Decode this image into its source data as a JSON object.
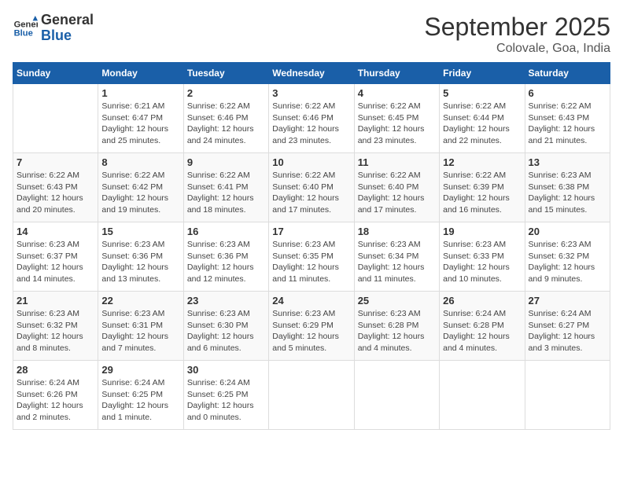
{
  "header": {
    "logo_line1": "General",
    "logo_line2": "Blue",
    "month": "September 2025",
    "location": "Colovale, Goa, India"
  },
  "weekdays": [
    "Sunday",
    "Monday",
    "Tuesday",
    "Wednesday",
    "Thursday",
    "Friday",
    "Saturday"
  ],
  "weeks": [
    [
      {
        "day": "",
        "info": ""
      },
      {
        "day": "1",
        "info": "Sunrise: 6:21 AM\nSunset: 6:47 PM\nDaylight: 12 hours\nand 25 minutes."
      },
      {
        "day": "2",
        "info": "Sunrise: 6:22 AM\nSunset: 6:46 PM\nDaylight: 12 hours\nand 24 minutes."
      },
      {
        "day": "3",
        "info": "Sunrise: 6:22 AM\nSunset: 6:46 PM\nDaylight: 12 hours\nand 23 minutes."
      },
      {
        "day": "4",
        "info": "Sunrise: 6:22 AM\nSunset: 6:45 PM\nDaylight: 12 hours\nand 23 minutes."
      },
      {
        "day": "5",
        "info": "Sunrise: 6:22 AM\nSunset: 6:44 PM\nDaylight: 12 hours\nand 22 minutes."
      },
      {
        "day": "6",
        "info": "Sunrise: 6:22 AM\nSunset: 6:43 PM\nDaylight: 12 hours\nand 21 minutes."
      }
    ],
    [
      {
        "day": "7",
        "info": "Sunrise: 6:22 AM\nSunset: 6:43 PM\nDaylight: 12 hours\nand 20 minutes."
      },
      {
        "day": "8",
        "info": "Sunrise: 6:22 AM\nSunset: 6:42 PM\nDaylight: 12 hours\nand 19 minutes."
      },
      {
        "day": "9",
        "info": "Sunrise: 6:22 AM\nSunset: 6:41 PM\nDaylight: 12 hours\nand 18 minutes."
      },
      {
        "day": "10",
        "info": "Sunrise: 6:22 AM\nSunset: 6:40 PM\nDaylight: 12 hours\nand 17 minutes."
      },
      {
        "day": "11",
        "info": "Sunrise: 6:22 AM\nSunset: 6:40 PM\nDaylight: 12 hours\nand 17 minutes."
      },
      {
        "day": "12",
        "info": "Sunrise: 6:22 AM\nSunset: 6:39 PM\nDaylight: 12 hours\nand 16 minutes."
      },
      {
        "day": "13",
        "info": "Sunrise: 6:23 AM\nSunset: 6:38 PM\nDaylight: 12 hours\nand 15 minutes."
      }
    ],
    [
      {
        "day": "14",
        "info": "Sunrise: 6:23 AM\nSunset: 6:37 PM\nDaylight: 12 hours\nand 14 minutes."
      },
      {
        "day": "15",
        "info": "Sunrise: 6:23 AM\nSunset: 6:36 PM\nDaylight: 12 hours\nand 13 minutes."
      },
      {
        "day": "16",
        "info": "Sunrise: 6:23 AM\nSunset: 6:36 PM\nDaylight: 12 hours\nand 12 minutes."
      },
      {
        "day": "17",
        "info": "Sunrise: 6:23 AM\nSunset: 6:35 PM\nDaylight: 12 hours\nand 11 minutes."
      },
      {
        "day": "18",
        "info": "Sunrise: 6:23 AM\nSunset: 6:34 PM\nDaylight: 12 hours\nand 11 minutes."
      },
      {
        "day": "19",
        "info": "Sunrise: 6:23 AM\nSunset: 6:33 PM\nDaylight: 12 hours\nand 10 minutes."
      },
      {
        "day": "20",
        "info": "Sunrise: 6:23 AM\nSunset: 6:32 PM\nDaylight: 12 hours\nand 9 minutes."
      }
    ],
    [
      {
        "day": "21",
        "info": "Sunrise: 6:23 AM\nSunset: 6:32 PM\nDaylight: 12 hours\nand 8 minutes."
      },
      {
        "day": "22",
        "info": "Sunrise: 6:23 AM\nSunset: 6:31 PM\nDaylight: 12 hours\nand 7 minutes."
      },
      {
        "day": "23",
        "info": "Sunrise: 6:23 AM\nSunset: 6:30 PM\nDaylight: 12 hours\nand 6 minutes."
      },
      {
        "day": "24",
        "info": "Sunrise: 6:23 AM\nSunset: 6:29 PM\nDaylight: 12 hours\nand 5 minutes."
      },
      {
        "day": "25",
        "info": "Sunrise: 6:23 AM\nSunset: 6:28 PM\nDaylight: 12 hours\nand 4 minutes."
      },
      {
        "day": "26",
        "info": "Sunrise: 6:24 AM\nSunset: 6:28 PM\nDaylight: 12 hours\nand 4 minutes."
      },
      {
        "day": "27",
        "info": "Sunrise: 6:24 AM\nSunset: 6:27 PM\nDaylight: 12 hours\nand 3 minutes."
      }
    ],
    [
      {
        "day": "28",
        "info": "Sunrise: 6:24 AM\nSunset: 6:26 PM\nDaylight: 12 hours\nand 2 minutes."
      },
      {
        "day": "29",
        "info": "Sunrise: 6:24 AM\nSunset: 6:25 PM\nDaylight: 12 hours\nand 1 minute."
      },
      {
        "day": "30",
        "info": "Sunrise: 6:24 AM\nSunset: 6:25 PM\nDaylight: 12 hours\nand 0 minutes."
      },
      {
        "day": "",
        "info": ""
      },
      {
        "day": "",
        "info": ""
      },
      {
        "day": "",
        "info": ""
      },
      {
        "day": "",
        "info": ""
      }
    ]
  ]
}
